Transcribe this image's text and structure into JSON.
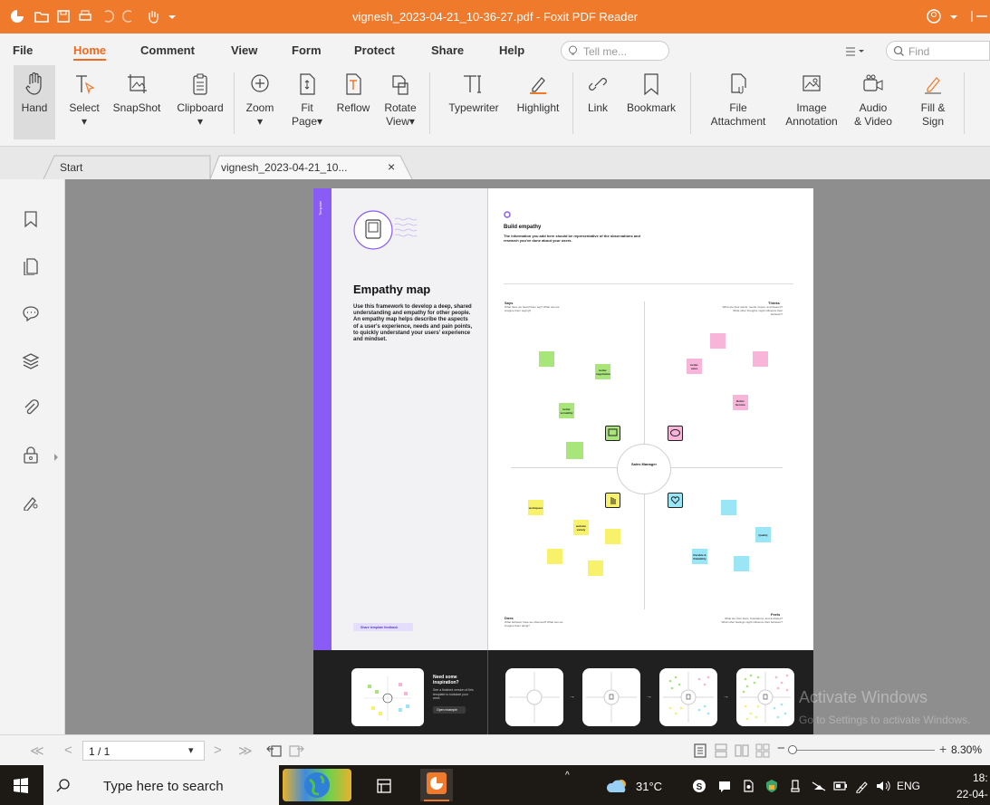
{
  "window": {
    "title": "vignesh_2023-04-21_10-36-27.pdf - Foxit PDF Reader"
  },
  "menu": {
    "items": [
      "File",
      "Home",
      "Comment",
      "View",
      "Form",
      "Protect",
      "Share",
      "Help"
    ],
    "active": "Home",
    "tell_me": "Tell me...",
    "find": "Find"
  },
  "ribbon": {
    "hand": "Hand",
    "select": "Select",
    "snapshot": "SnapShot",
    "clipboard": "Clipboard",
    "zoom": "Zoom",
    "fit_page_1": "Fit",
    "fit_page_2": "Page",
    "reflow": "Reflow",
    "rotate_1": "Rotate",
    "rotate_2": "View",
    "typewriter": "Typewriter",
    "highlight": "Highlight",
    "link": "Link",
    "bookmark": "Bookmark",
    "file_att_1": "File",
    "file_att_2": "Attachment",
    "image_ann_1": "Image",
    "image_ann_2": "Annotation",
    "audio_1": "Audio",
    "audio_2": "& Video",
    "fill_1": "Fill &",
    "fill_2": "Sign"
  },
  "tabs": {
    "start": "Start",
    "doc": "vignesh_2023-04-21_10...",
    "close": "×"
  },
  "pdf": {
    "side_tag": "Template",
    "heading": "Empathy map",
    "description": "Use this framework to develop a deep, shared understanding and empathy for other people. An empathy map helps describe the aspects of a user's experience, needs and pain points, to quickly understand your users' experience and mindset.",
    "feedback": "Share template feedback",
    "build_title": "Build empathy",
    "build_desc": "The information you add here should be representative of the observations and research you've done about your users.",
    "says": "Says",
    "says_sub": "What have we heard them say? What can we imagine them saying?",
    "thinks": "Thinks",
    "thinks_sub": "What are their wants, needs, hopes, and dreams? What other thoughts might influence their behavior?",
    "does": "Does",
    "does_sub": "What behavior have we observed? What can we imagine them doing?",
    "feels": "Feels",
    "feels_sub": "What are their fears, frustrations, and anxieties? What other feelings might influence their behavior?",
    "center": "Sales Manager",
    "sticky_better_negotiation": "better negotiation",
    "sticky_better_versatility": "better versatility",
    "sticky_better_sales": "better sales",
    "sticky_better_service": "Better Service",
    "sticky_workspace": "workspace",
    "sticky_website_variety": "website variety",
    "sticky_quality": "Quality",
    "sticky_durability": "Durable & Reliability",
    "inspo_title": "Need some inspiration?",
    "inspo_desc": "See a finished version of this template to kickstart your work.",
    "inspo_btn": "Open example"
  },
  "status": {
    "page": "1 / 1",
    "zoom": "8.30%"
  },
  "taskbar": {
    "search": "Type here to search",
    "weather": "31°C",
    "lang": "ENG",
    "time": "18:",
    "date": "22-04-"
  },
  "watermark": {
    "line1": "Activate Windows",
    "line2": "Go to Settings to activate Windows."
  },
  "colors": {
    "accent": "#ef7a2b",
    "purple": "#8a5cf6",
    "green": "#a8e67a",
    "pink": "#f8b4d9",
    "yellow": "#f7f26a",
    "blue": "#9ae6f7"
  }
}
